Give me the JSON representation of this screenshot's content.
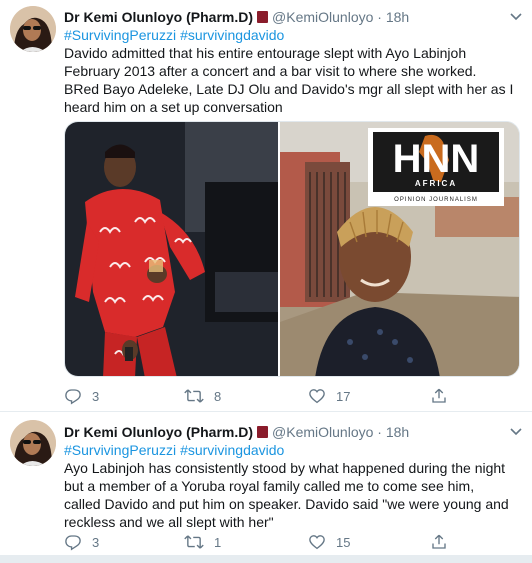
{
  "tweets": [
    {
      "name": "Dr Kemi Olunloyo (Pharm.D)",
      "handle": "@KemiOlunloyo",
      "time": "18h",
      "hashtags": [
        "#SurvivingPeruzzi",
        "#survivingdavido"
      ],
      "text": "Davido admitted that his entire entourage slept with Ayo Labinjoh February 2013 after a concert and a bar visit to where she worked. BRed Bayo Adeleke, Late DJ Olu and Davido's mgr all slept with her as I heard him on a set up conversation",
      "media_logo": {
        "main": "HNN",
        "sub1": "AFRICA",
        "sub2": "OPINION JOURNALISM"
      },
      "replies": "3",
      "retweets": "8",
      "likes": "17"
    },
    {
      "name": "Dr Kemi Olunloyo (Pharm.D)",
      "handle": "@KemiOlunloyo",
      "time": "18h",
      "hashtags": [
        "#SurvivingPeruzzi",
        "#survivingdavido"
      ],
      "text": "Ayo Labinjoh has consistently stood by what happened during the night but a member of a Yoruba royal family called me to come see him, called Davido and put him on speaker. Davido said \"we were young and reckless and we all slept with her\"",
      "replies": "3",
      "retweets": "1",
      "likes": "15"
    }
  ],
  "colors": {
    "link": "#1b95e0",
    "muted": "#657786",
    "text": "#14171a",
    "flag": "#8a1c2b"
  }
}
